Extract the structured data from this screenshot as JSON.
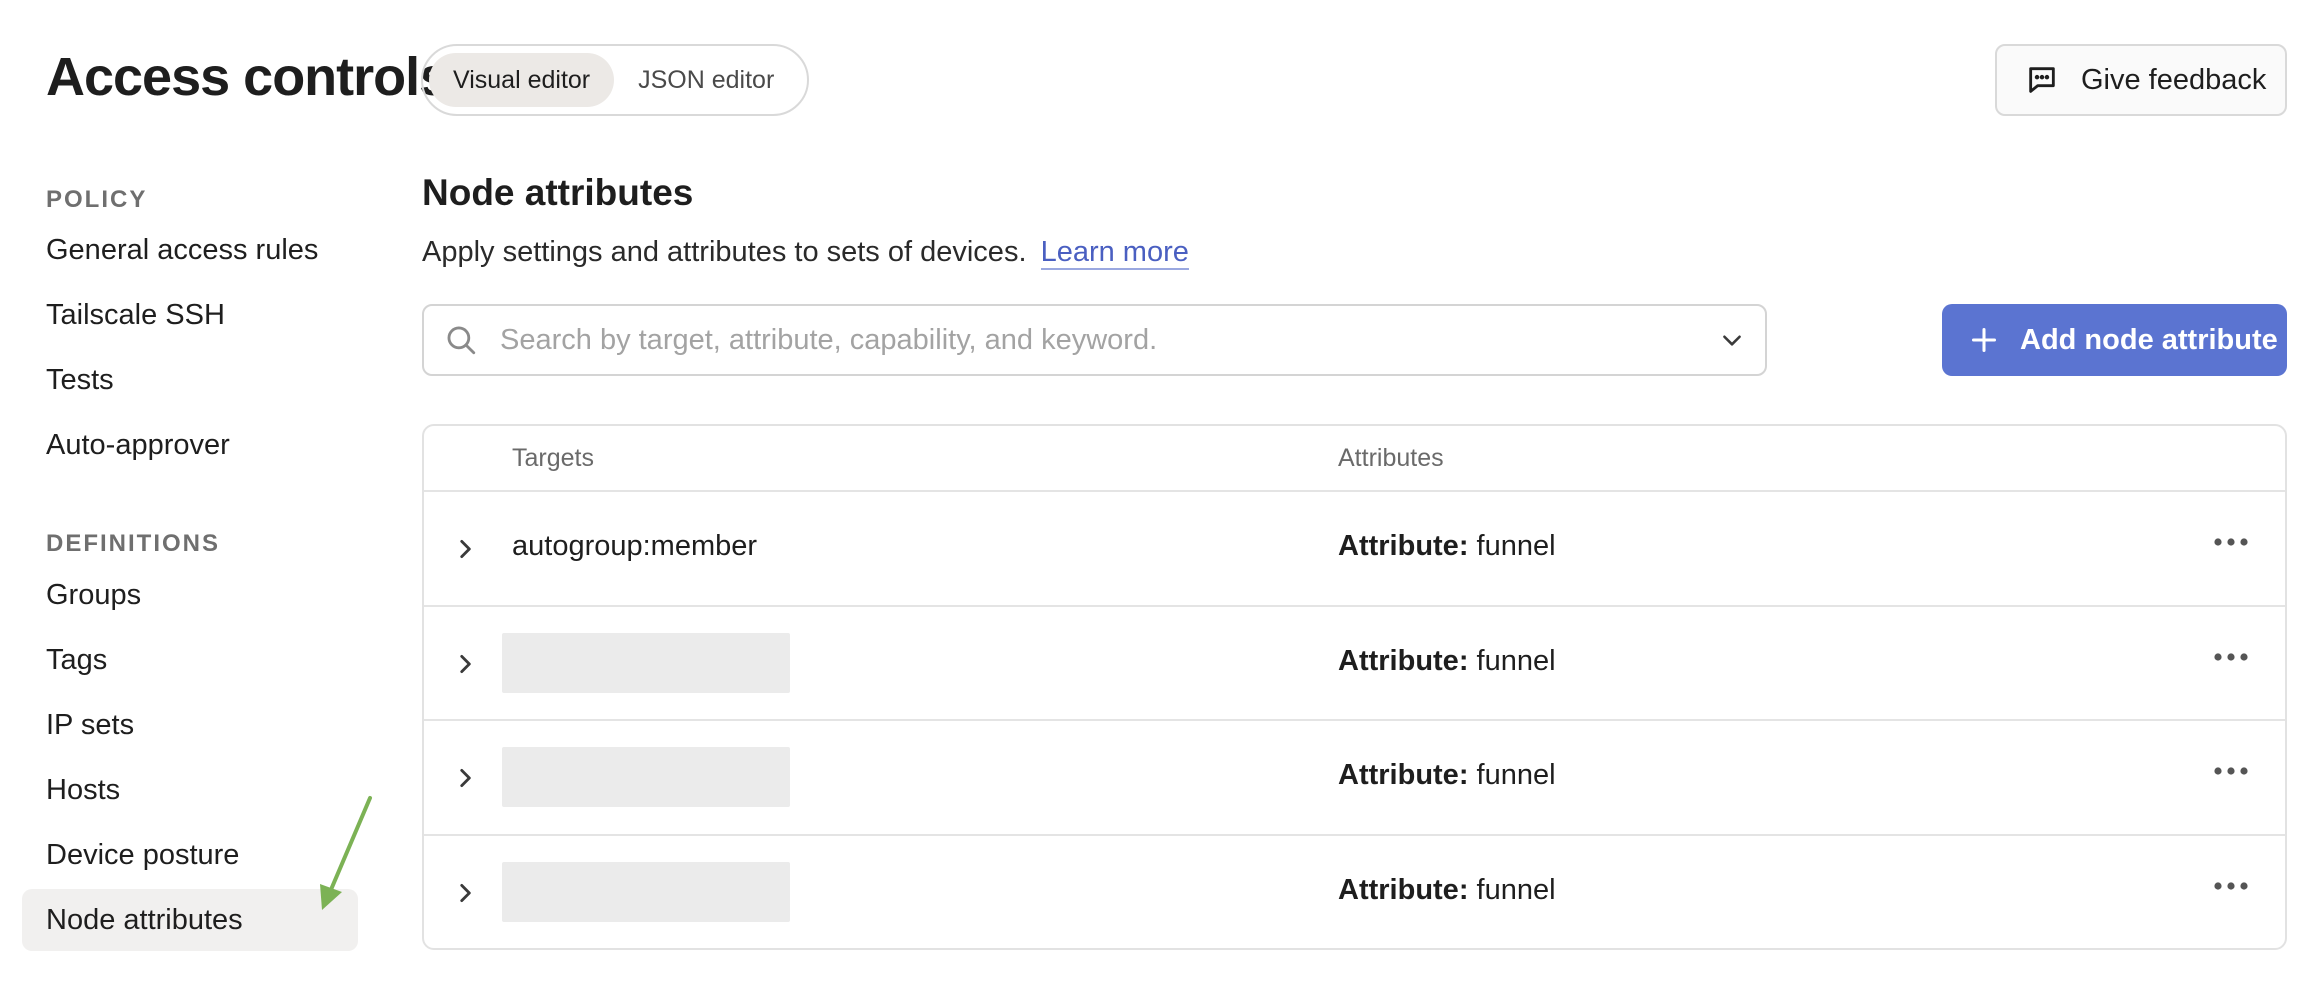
{
  "header": {
    "title": "Access controls",
    "editor_tabs": [
      {
        "label": "Visual editor",
        "active": true
      },
      {
        "label": "JSON editor",
        "active": false
      }
    ],
    "feedback_label": "Give feedback",
    "feedback_icon": "message-square-icon"
  },
  "sidebar": {
    "policy_heading": "POLICY",
    "policy_items": [
      "General access rules",
      "Tailscale SSH",
      "Tests",
      "Auto-approver"
    ],
    "definitions_heading": "DEFINITIONS",
    "definitions_items": [
      "Groups",
      "Tags",
      "IP sets",
      "Hosts",
      "Device posture",
      "Node attributes"
    ],
    "active_item": "Node attributes"
  },
  "main": {
    "title": "Node attributes",
    "description": "Apply settings and attributes to sets of devices.",
    "learn_more": "Learn more",
    "search_placeholder": "Search by target, attribute, capability, and keyword.",
    "add_button": "Add node attribute",
    "accent_color": "#5b74d1",
    "table": {
      "columns": [
        "Targets",
        "Attributes"
      ],
      "rows": [
        {
          "target": "autogroup:member",
          "attr_label": "Attribute:",
          "attr_value": "funnel"
        },
        {
          "target": "",
          "attr_label": "Attribute:",
          "attr_value": "funnel"
        },
        {
          "target": "",
          "attr_label": "Attribute:",
          "attr_value": "funnel"
        },
        {
          "target": "",
          "attr_label": "Attribute:",
          "attr_value": "funnel"
        }
      ]
    }
  },
  "annotation": {
    "arrow_color": "#7cb255"
  }
}
